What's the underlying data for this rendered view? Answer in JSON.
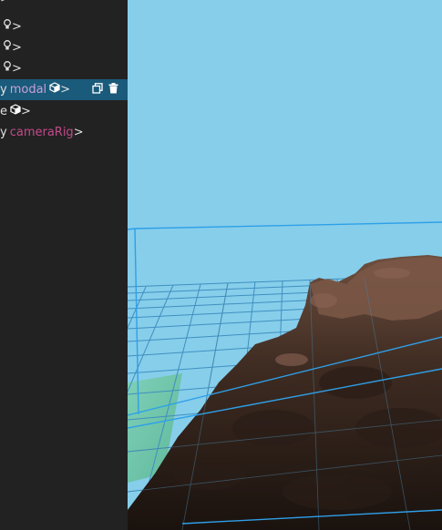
{
  "sidebar": {
    "items": [
      {
        "suffix": ">"
      },
      {
        "suffix": ">"
      },
      {
        "suffix": ">"
      },
      {
        "prefix": "y",
        "name": "modal",
        "suffix": ">"
      },
      {
        "prefix": "e",
        "suffix": ">"
      },
      {
        "prefix": "y",
        "name": "cameraRig",
        "suffix": ">"
      }
    ]
  },
  "colors": {
    "sidebar_bg": "#222222",
    "selected_row": "#1a5a7a",
    "sky": "#87ceeb",
    "grid": "#3fa8e0",
    "entity_name": "#c44a8a"
  },
  "icons": [
    "lightbulb-icon",
    "cube-icon",
    "copy-icon",
    "trash-icon"
  ]
}
